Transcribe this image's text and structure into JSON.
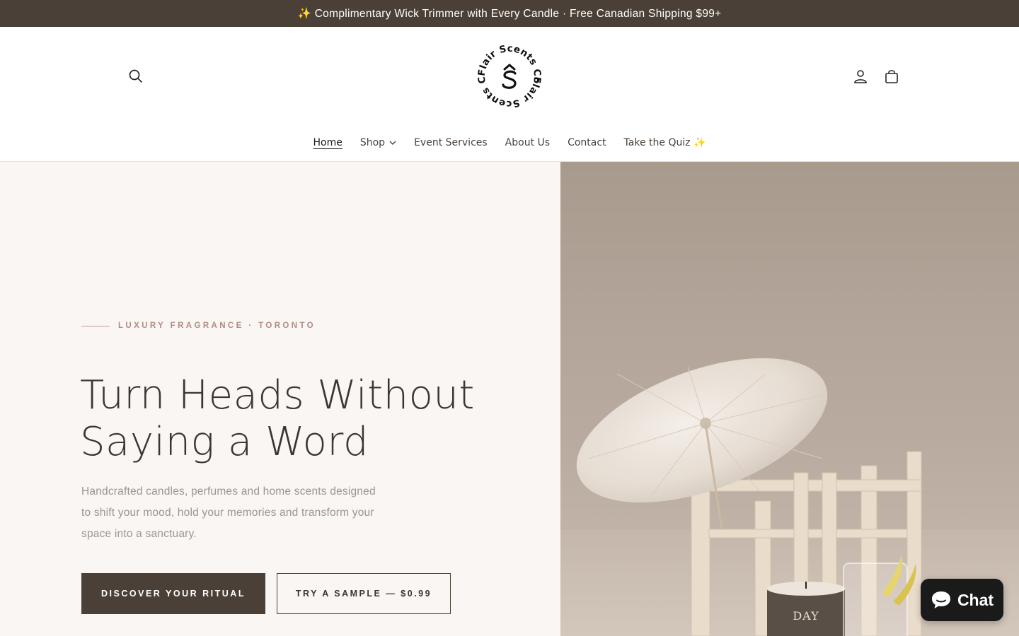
{
  "announcement": "✨ Complimentary Wick Trimmer with Every Candle · Free Canadian Shipping $99+",
  "brand": {
    "logo_text": "Flair Scents Co",
    "logo_mark": "S"
  },
  "nav": {
    "items": [
      {
        "label": "Home",
        "active": true
      },
      {
        "label": "Shop",
        "has_dropdown": true
      },
      {
        "label": "Event Services"
      },
      {
        "label": "About Us"
      },
      {
        "label": "Contact"
      },
      {
        "label": "Take the Quiz ✨"
      }
    ]
  },
  "hero": {
    "eyebrow": "LUXURY FRAGRANCE · TORONTO",
    "title_line1": "Turn Heads Without",
    "title_line2": "Saying a Word",
    "subtitle": "Handcrafted candles, perfumes and home scents designed to shift your mood, hold your memories and transform your space into a sanctuary.",
    "primary_cta": "DISCOVER YOUR RITUAL",
    "secondary_cta": "TRY A SAMPLE — $0.99",
    "candle_label": "DAY"
  },
  "chat": {
    "label": "Chat"
  },
  "icons": [
    "search-icon",
    "account-icon",
    "cart-icon",
    "chevron-down-icon",
    "chat-bubble-icon"
  ],
  "colors": {
    "announcement_bg": "#4a4038",
    "accent": "#c49a94",
    "button_dark": "#4a4038",
    "hero_bg": "#faf6f3"
  }
}
